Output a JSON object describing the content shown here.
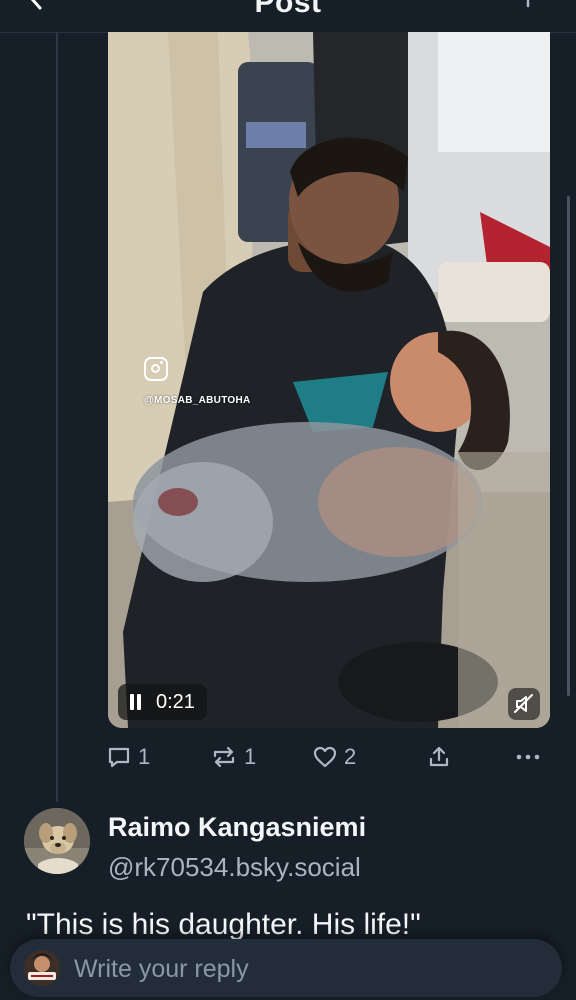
{
  "header": {
    "title": "Post"
  },
  "video": {
    "watermark_handle": "@MOSAB_ABUTOHA",
    "time": "0:21",
    "icons": {
      "instagram": "instagram-icon",
      "pause": "pause-icon",
      "mute": "mute-icon"
    }
  },
  "actions": {
    "reply_count": "1",
    "repost_count": "1",
    "like_count": "2"
  },
  "reply_post": {
    "author_name": "Raimo Kangasniemi",
    "author_handle": "@rk70534.bsky.social",
    "text": "\"This is his daughter. His life!\""
  },
  "composer": {
    "placeholder": "Write your reply"
  },
  "colors": {
    "background": "#161e27",
    "text_secondary": "#aeb8c4",
    "composer_bg": "#232d39"
  }
}
